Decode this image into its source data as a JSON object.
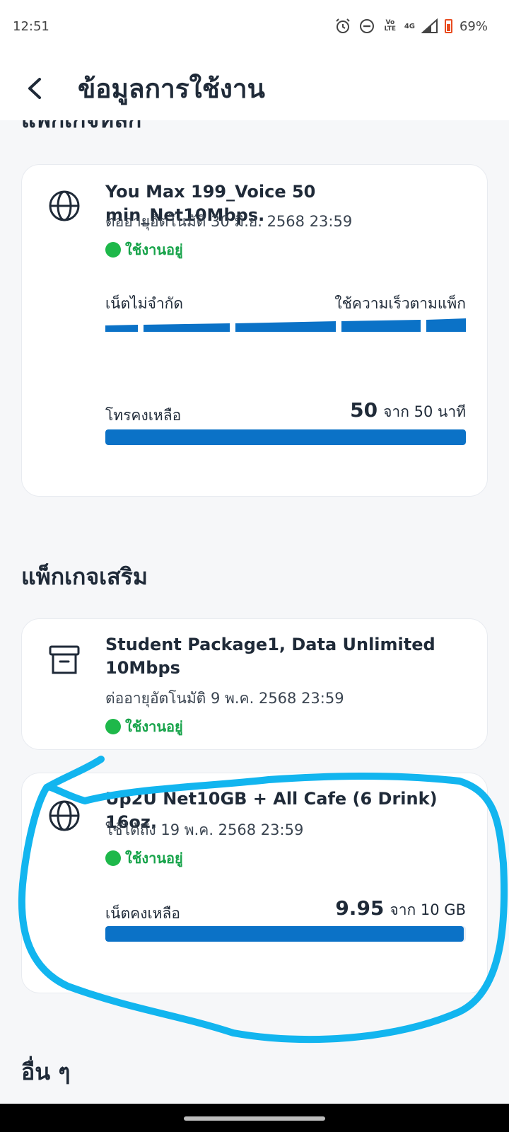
{
  "status_bar": {
    "time": "12:51",
    "volte_label": "Vo LTE",
    "network_label": "4G",
    "battery_text": "69%"
  },
  "header": {
    "title": "ข้อมูลการใช้งาน",
    "back_icon": "chevron-left-icon"
  },
  "main_section": {
    "title_partial": "แพ็กเกจหลัก",
    "package": {
      "icon": "globe-icon",
      "name": "You Max 199_Voice 50 min_Net10Mbps.",
      "expiry": "ต่ออายุอัตโนมัติ 30 มิ.ย. 2568 23:59",
      "status": "ใช้งานอยู่",
      "internet": {
        "label": "เน็ตไม่จำกัด",
        "speed_label": "ใช้ความเร็วตามแพ็ก"
      },
      "voice": {
        "label": "โทรคงเหลือ",
        "remaining": "50",
        "total_text": "จาก 50 นาที",
        "fraction": 1.0
      }
    }
  },
  "addon_section": {
    "title": "แพ็กเกจเสริม",
    "packages": [
      {
        "icon": "archive-box-icon",
        "name": "Student Package1, Data Unlimited 10Mbps",
        "expiry": "ต่ออายุอัตโนมัติ 9 พ.ค. 2568 23:59",
        "status": "ใช้งานอยู่"
      },
      {
        "icon": "globe-icon",
        "name": "Up2U Net10GB + All Cafe (6 Drink) 16oz.",
        "expiry": "ใช้ได้ถึง 19 พ.ค. 2568 23:59",
        "status": "ใช้งานอยู่",
        "data": {
          "label": "เน็ตคงเหลือ",
          "remaining": "9.95",
          "total_text": "จาก 10 GB",
          "fraction": 0.995
        }
      }
    ]
  },
  "other_section": {
    "title": "อื่น ๆ"
  },
  "colors": {
    "accent": "#0b72c7",
    "status_green": "#1eb84a",
    "annotation": "#12b5ef"
  }
}
